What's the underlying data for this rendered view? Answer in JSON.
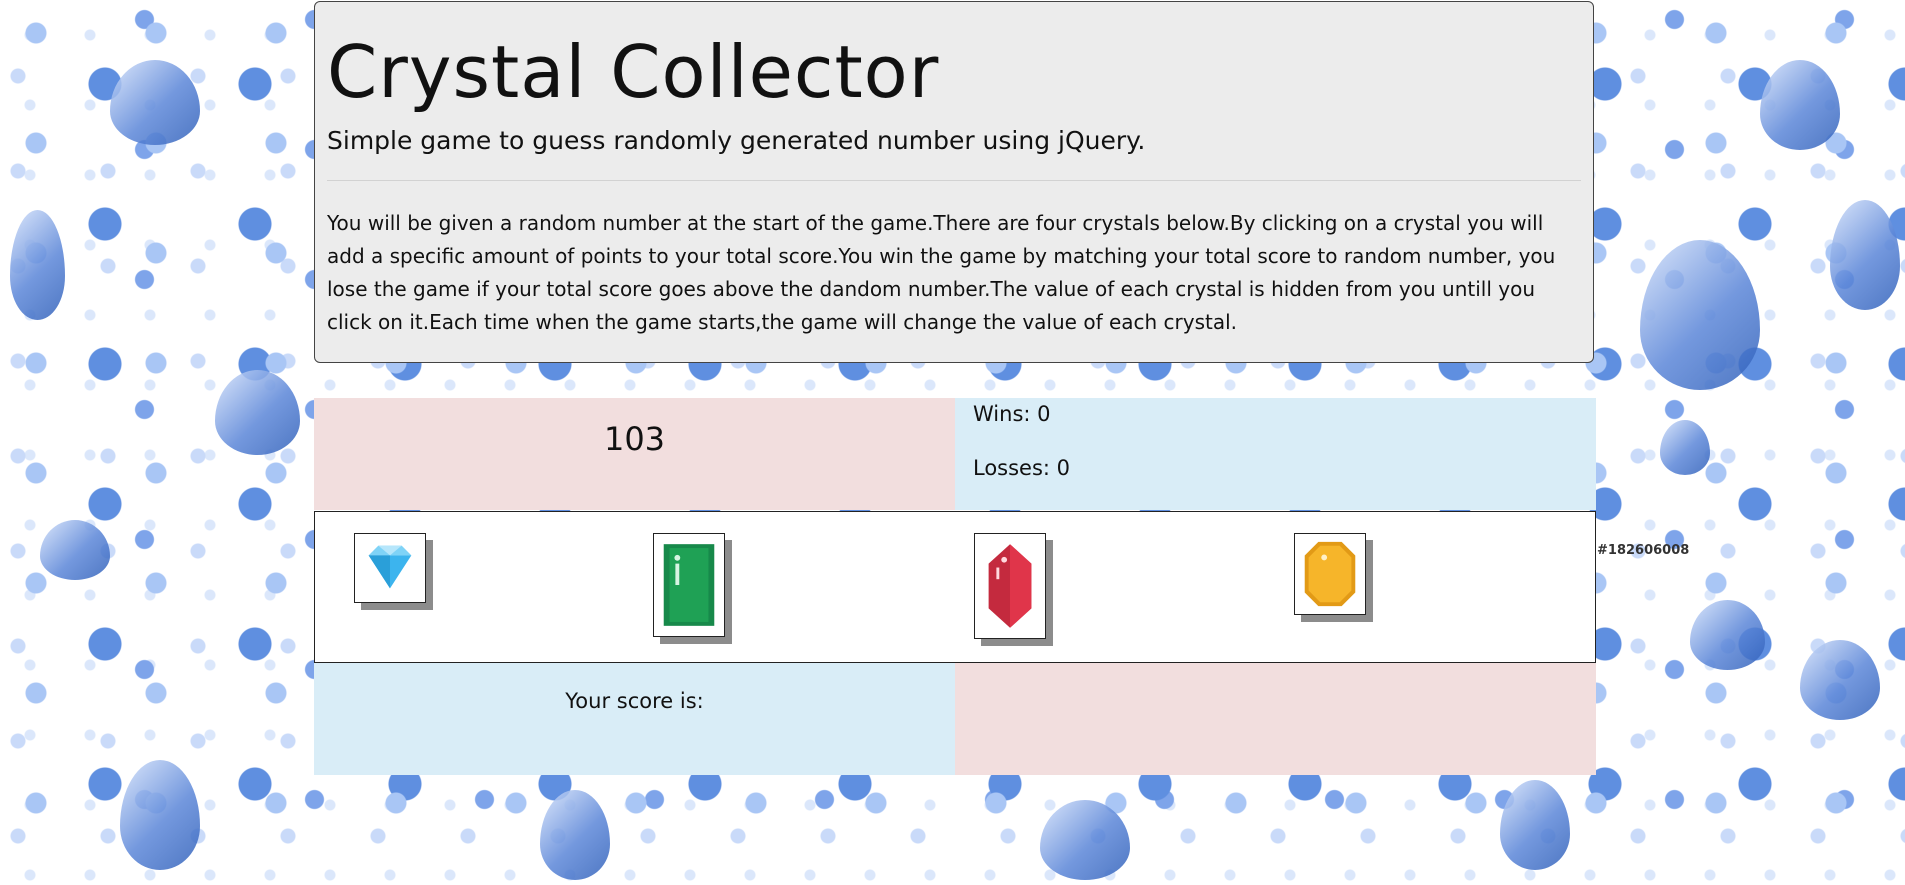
{
  "header": {
    "title": "Crystal Collector",
    "subtitle": "Simple game to guess randomly generated number using jQuery.",
    "description": "You will be given a random number at the start of the game.There are four crystals below.By clicking on a crystal you will add a specific amount of points to your total score.You win the game by matching your total score to random number, you lose the game if your total score goes above the dandom number.The value of each crystal is hidden from you untill you click on it.Each time when the game starts,the game will change the value of each crystal."
  },
  "game": {
    "target_number": "103",
    "wins_text": "Wins: 0",
    "losses_text": "Losses: 0",
    "score_label": "Your score is:",
    "score_value": ""
  },
  "crystals": [
    {
      "icon": "blue-diamond-icon",
      "color": "#3cb4ee"
    },
    {
      "icon": "green-crystal-icon",
      "color": "#1fa155"
    },
    {
      "icon": "red-crystal-icon",
      "color": "#e0354a"
    },
    {
      "icon": "yellow-crystal-icon",
      "color": "#f6b52a"
    }
  ],
  "background": {
    "watermark_id": "#182606008"
  },
  "colors": {
    "jumbotron_bg": "#ececec",
    "pink_panel": "#f2dede",
    "blue_panel": "#d9edf7"
  }
}
